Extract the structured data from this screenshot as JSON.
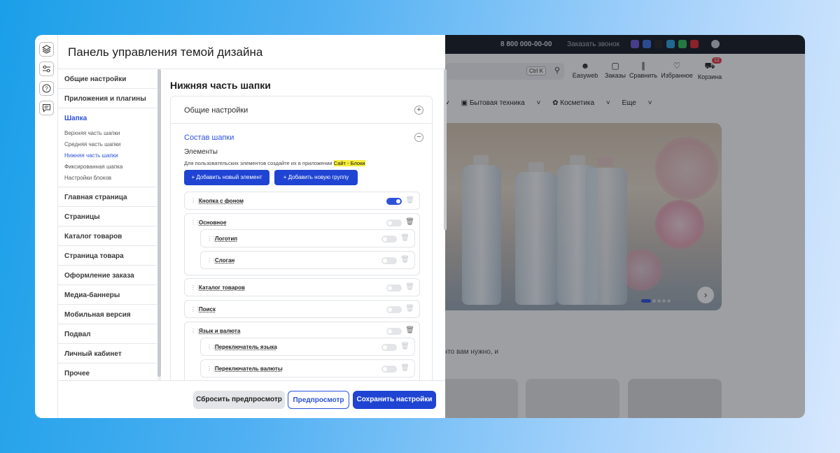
{
  "panel": {
    "title": "Панель управления темой дизайна"
  },
  "sidebar": {
    "items": [
      {
        "label": "Общие настройки"
      },
      {
        "label": "Приложения и плагины"
      },
      {
        "label": "Шапка"
      },
      {
        "label": "Главная страница"
      },
      {
        "label": "Страницы"
      },
      {
        "label": "Каталог товаров"
      },
      {
        "label": "Страница товара"
      },
      {
        "label": "Оформление заказа"
      },
      {
        "label": "Медиа-баннеры"
      },
      {
        "label": "Мобильная версия"
      },
      {
        "label": "Подвал"
      },
      {
        "label": "Личный кабинет"
      },
      {
        "label": "Прочее"
      }
    ],
    "header_subitems": [
      {
        "label": "Верхняя часть шапки"
      },
      {
        "label": "Средняя часть шапки"
      },
      {
        "label": "Нижняя часть шапки"
      },
      {
        "label": "Фиксированная шапка"
      },
      {
        "label": "Настройки блоков"
      }
    ]
  },
  "content": {
    "title": "Нижняя часть шапки",
    "general_settings": "Общие настройки",
    "composition": "Состав шапки",
    "elements_title": "Элементы",
    "hint_prefix": "Для пользовательских элементов создайте их в приложении ",
    "hint_link": "Сайт - Блоки",
    "add_element": "+ Добавить новый элемент",
    "add_group": "+ Добавить новую группу",
    "rows": [
      {
        "label": "Кнопка с фоном",
        "enabled": true
      },
      {
        "label": "Основное",
        "enabled": false
      },
      {
        "label": "Логотип",
        "enabled": false
      },
      {
        "label": "Слоган",
        "enabled": false
      },
      {
        "label": "Каталог товаров",
        "enabled": false
      },
      {
        "label": "Поиск",
        "enabled": false
      },
      {
        "label": "Язык и валюта",
        "enabled": false
      },
      {
        "label": "Переключатель языка",
        "enabled": false
      },
      {
        "label": "Переключатель валюты",
        "enabled": false
      }
    ]
  },
  "footer": {
    "reset": "Сбросить предпросмотр",
    "preview": "Предпросмотр",
    "save": "Сохранить настройки"
  },
  "site": {
    "phone": "8 800 000-00-00",
    "callback": "Заказать звонок",
    "search_shortcut": "Ctrl K",
    "nav": [
      "Easyweb",
      "Заказы",
      "Сравнить",
      "Избранное",
      "Корзина"
    ],
    "cart_count": "12",
    "menu": [
      "Бытовая техника",
      "Косметика",
      "Еще"
    ],
    "partial_text": "что вам нужно, и"
  },
  "colors": {
    "accent": "#2b52d9",
    "button": "#1f44d3",
    "highlight": "#f7ee3a"
  }
}
